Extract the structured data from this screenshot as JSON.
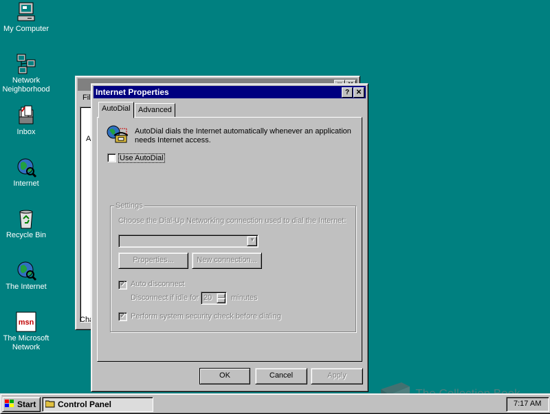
{
  "desktop": {
    "icons": [
      {
        "label_line1": "My Computer",
        "label_line2": ""
      },
      {
        "label_line1": "Network",
        "label_line2": "Neighborhood"
      },
      {
        "label_line1": "Inbox",
        "label_line2": ""
      },
      {
        "label_line1": "Internet",
        "label_line2": ""
      },
      {
        "label_line1": "Recycle Bin",
        "label_line2": ""
      },
      {
        "label_line1": "The Internet",
        "label_line2": ""
      },
      {
        "label_line1": "The Microsoft",
        "label_line2": "Network"
      }
    ],
    "background_color": "#008080"
  },
  "background_window": {
    "menu_fragment": "Fil",
    "body_fragment": "A",
    "status_fragment": "Cha"
  },
  "dialog": {
    "title": "Internet Properties",
    "help_button": "?",
    "close_button": "✕",
    "tabs": [
      {
        "label": "AutoDial",
        "selected": true
      },
      {
        "label": "Advanced",
        "selected": false
      }
    ],
    "description": "AutoDial dials the Internet automatically whenever an application needs Internet access.",
    "use_autodial_label": "Use AutoDial",
    "use_autodial_checked": false,
    "settings": {
      "group_label": "Settings",
      "choose_label": "Choose the Dial-Up Networking connection used to dial the Internet:",
      "connection_value": "",
      "properties_button": "Properties...",
      "new_connection_button": "New connection...",
      "auto_disconnect_label": "Auto disconnect",
      "auto_disconnect_checked": true,
      "disconnect_prefix": "Disconnect if idle for",
      "idle_minutes": "20",
      "disconnect_suffix": "minutes",
      "security_check_label": "Perform system security check before dialing",
      "security_check_checked": true
    },
    "buttons": {
      "ok": "OK",
      "cancel": "Cancel",
      "apply": "Apply"
    }
  },
  "taskbar": {
    "start_label": "Start",
    "task_label": "Control Panel",
    "clock": "7:17 AM"
  },
  "watermark": "The Collection Book"
}
